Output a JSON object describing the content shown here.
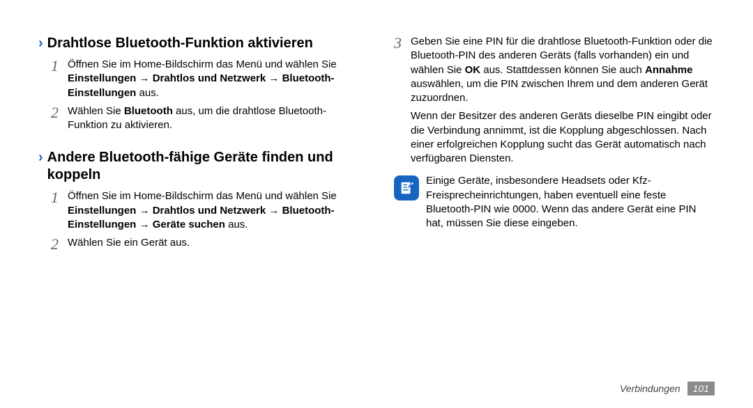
{
  "left": {
    "section1": {
      "title": "Drahtlose Bluetooth-Funktion aktivieren",
      "steps": [
        {
          "num": "1",
          "parts": [
            {
              "t": "Öffnen Sie im Home-Bildschirm das Menü und wählen Sie "
            },
            {
              "t": "Einstellungen",
              "b": true
            },
            {
              "t": " → "
            },
            {
              "t": "Drahtlos und Netzwerk",
              "b": true
            },
            {
              "t": " → "
            },
            {
              "t": "Bluetooth-Einstellungen",
              "b": true
            },
            {
              "t": " aus."
            }
          ]
        },
        {
          "num": "2",
          "parts": [
            {
              "t": "Wählen Sie "
            },
            {
              "t": "Bluetooth",
              "b": true
            },
            {
              "t": " aus, um die drahtlose Bluetooth-Funktion zu aktivieren."
            }
          ]
        }
      ]
    },
    "section2": {
      "title": "Andere Bluetooth-fähige Geräte finden und koppeln",
      "steps": [
        {
          "num": "1",
          "parts": [
            {
              "t": "Öffnen Sie im Home-Bildschirm das Menü und wählen Sie "
            },
            {
              "t": "Einstellungen",
              "b": true
            },
            {
              "t": " → "
            },
            {
              "t": "Drahtlos und Netzwerk",
              "b": true
            },
            {
              "t": " → "
            },
            {
              "t": "Bluetooth-Einstellungen",
              "b": true
            },
            {
              "t": " → "
            },
            {
              "t": "Geräte suchen",
              "b": true
            },
            {
              "t": " aus."
            }
          ]
        },
        {
          "num": "2",
          "parts": [
            {
              "t": "Wählen Sie ein Gerät aus."
            }
          ]
        }
      ]
    }
  },
  "right": {
    "step3": {
      "num": "3",
      "parts": [
        {
          "t": "Geben Sie eine PIN für die drahtlose Bluetooth-Funktion oder die Bluetooth-PIN des anderen Geräts (falls vorhanden) ein und wählen Sie "
        },
        {
          "t": "OK",
          "b": true
        },
        {
          "t": " aus. Stattdessen können Sie auch "
        },
        {
          "t": "Annahme",
          "b": true
        },
        {
          "t": " auswählen, um die PIN zwischen Ihrem und dem anderen Gerät zuzuordnen."
        }
      ]
    },
    "para2": "Wenn der Besitzer des anderen Geräts dieselbe PIN eingibt oder die Verbindung annimmt, ist die Kopplung abgeschlossen. Nach einer erfolgreichen Kopplung sucht das Gerät automatisch nach verfügbaren Diensten.",
    "note": "Einige Geräte, insbesondere Headsets oder Kfz-Freisprecheinrichtungen, haben eventuell eine feste Bluetooth-PIN wie 0000. Wenn das andere Gerät eine PIN hat, müssen Sie diese eingeben."
  },
  "footer": {
    "label": "Verbindungen",
    "page": "101"
  }
}
